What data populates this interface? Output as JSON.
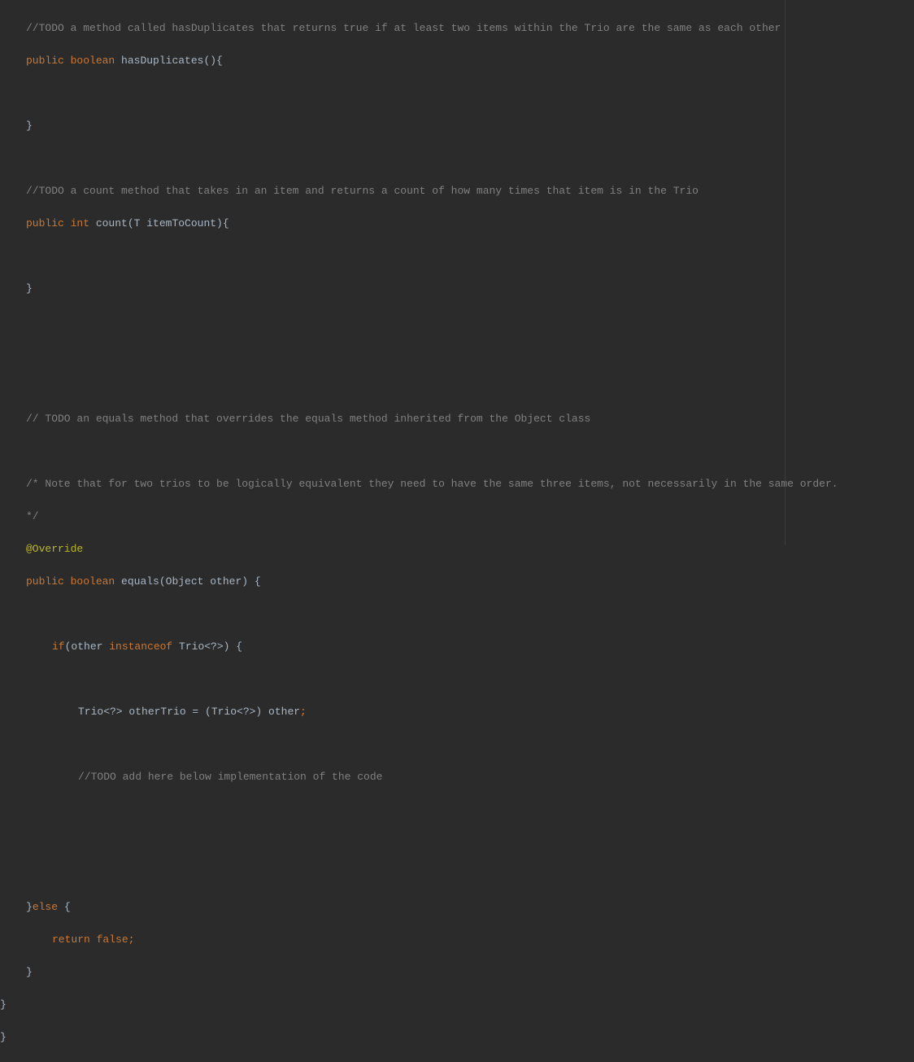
{
  "code": {
    "c1": "//TODO a method called hasDuplicates that returns true if at least two items within the Trio are the same as each other",
    "kw_public": "public",
    "kw_boolean": "boolean",
    "kw_int": "int",
    "kw_if": "if",
    "kw_else": "else",
    "kw_return": "return",
    "kw_false": "false",
    "kw_instanceof": "instanceof",
    "m_hasDup": " hasDuplicates(){",
    "close_brace": "}",
    "c2": "//TODO a count method that takes in an item and returns a count of how many times that item is in the Trio",
    "m_count": " count(T itemToCount){",
    "c3": "// TODO an equals method that overrides the equals method inherited from the Object class",
    "c4a": "/* Note that for two trios to be logically equivalent they need to have the same three items, not necessarily in the same order.",
    "c4b": "*/",
    "ann_override": "@Override",
    "m_equals": " equals(Object other) {",
    "if_open": "(other ",
    "if_close": " Trio<?>) {",
    "cast_line": "Trio<?> otherTrio = (Trio<?>) other",
    "semi": ";",
    "c5": "//TODO add here below implementation of the code",
    "else_open": " {",
    "ret_sp": " ",
    "close_else": "}"
  }
}
